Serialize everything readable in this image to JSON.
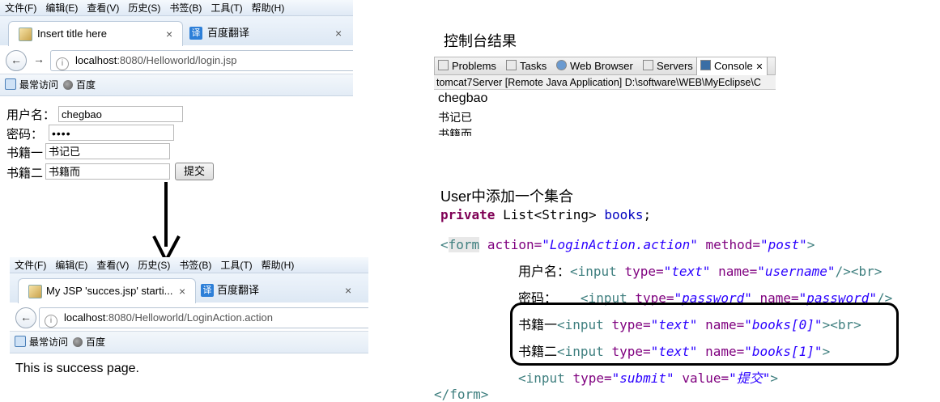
{
  "browser1": {
    "menu": [
      "文件(F)",
      "编辑(E)",
      "查看(V)",
      "历史(S)",
      "书签(B)",
      "工具(T)",
      "帮助(H)"
    ],
    "tabs": [
      {
        "label": "Insert title here",
        "close": "×"
      },
      {
        "label": "百度翻译",
        "close": "×"
      }
    ],
    "url_host": "localhost",
    "url_rest": ":8080/Helloworld/login.jsp",
    "bookmarks": [
      "最常访问",
      "百度"
    ],
    "form": {
      "username_label": "用户名：",
      "username_value": "chegbao",
      "password_label": "密码：",
      "password_value": "••••",
      "book1_label": "书籍一",
      "book1_value": "书记已",
      "book2_label": "书籍二",
      "book2_value": "书籍而",
      "submit_label": "提交"
    }
  },
  "browser2": {
    "menu": [
      "文件(F)",
      "编辑(E)",
      "查看(V)",
      "历史(S)",
      "书签(B)",
      "工具(T)",
      "帮助(H)"
    ],
    "tabs": [
      {
        "label": "My JSP 'succes.jsp' starti...",
        "close": "×"
      },
      {
        "label": "百度翻译",
        "close": "×"
      }
    ],
    "url_host": "localhost",
    "url_rest": ":8080/Helloworld/LoginAction.action",
    "bookmarks": [
      "最常访问",
      "百度"
    ],
    "body_text": "This is success page."
  },
  "console": {
    "heading": "控制台结果",
    "tabs": [
      "Problems",
      "Tasks",
      "Web Browser",
      "Servers",
      "Console"
    ],
    "close": "✕",
    "header_text": "tomcat7Server [Remote Java Application] D:\\software\\WEB\\MyEclipse\\C",
    "lines": [
      "chegbao",
      "书记已",
      "书籍而"
    ]
  },
  "code": {
    "note": "User中添加一个集合",
    "kw_private": "private",
    "field_type": "List<String>",
    "field_name": "books",
    "semicolon": ";",
    "lt": "<",
    "form_tag": "form",
    "action_attr": "action=",
    "action_val": "\"LoginAction.action\"",
    "method_attr": "method=",
    "method_val": "\"post\"",
    "gt": ">",
    "l_user": "用户名：",
    "l_pass": "密码：",
    "l_book1": "书籍一",
    "l_book2": "书籍二",
    "input_tag": "<input",
    "type_attr": "type=",
    "name_attr": "name=",
    "value_attr": "value=",
    "v_text": "\"text\"",
    "v_password": "\"password\"",
    "v_submit": "\"submit\"",
    "v_username": "\"username\"",
    "v_pass_name": "\"password\"",
    "v_books0": "\"books[0]\"",
    "v_books1": "\"books[1]\"",
    "v_submit_value": "\"提交\"",
    "end_br": "/><br>",
    "end_slash": "/>",
    "end_gt_br": "><br>",
    "end_gt": ">",
    "close_form": "</form>"
  }
}
